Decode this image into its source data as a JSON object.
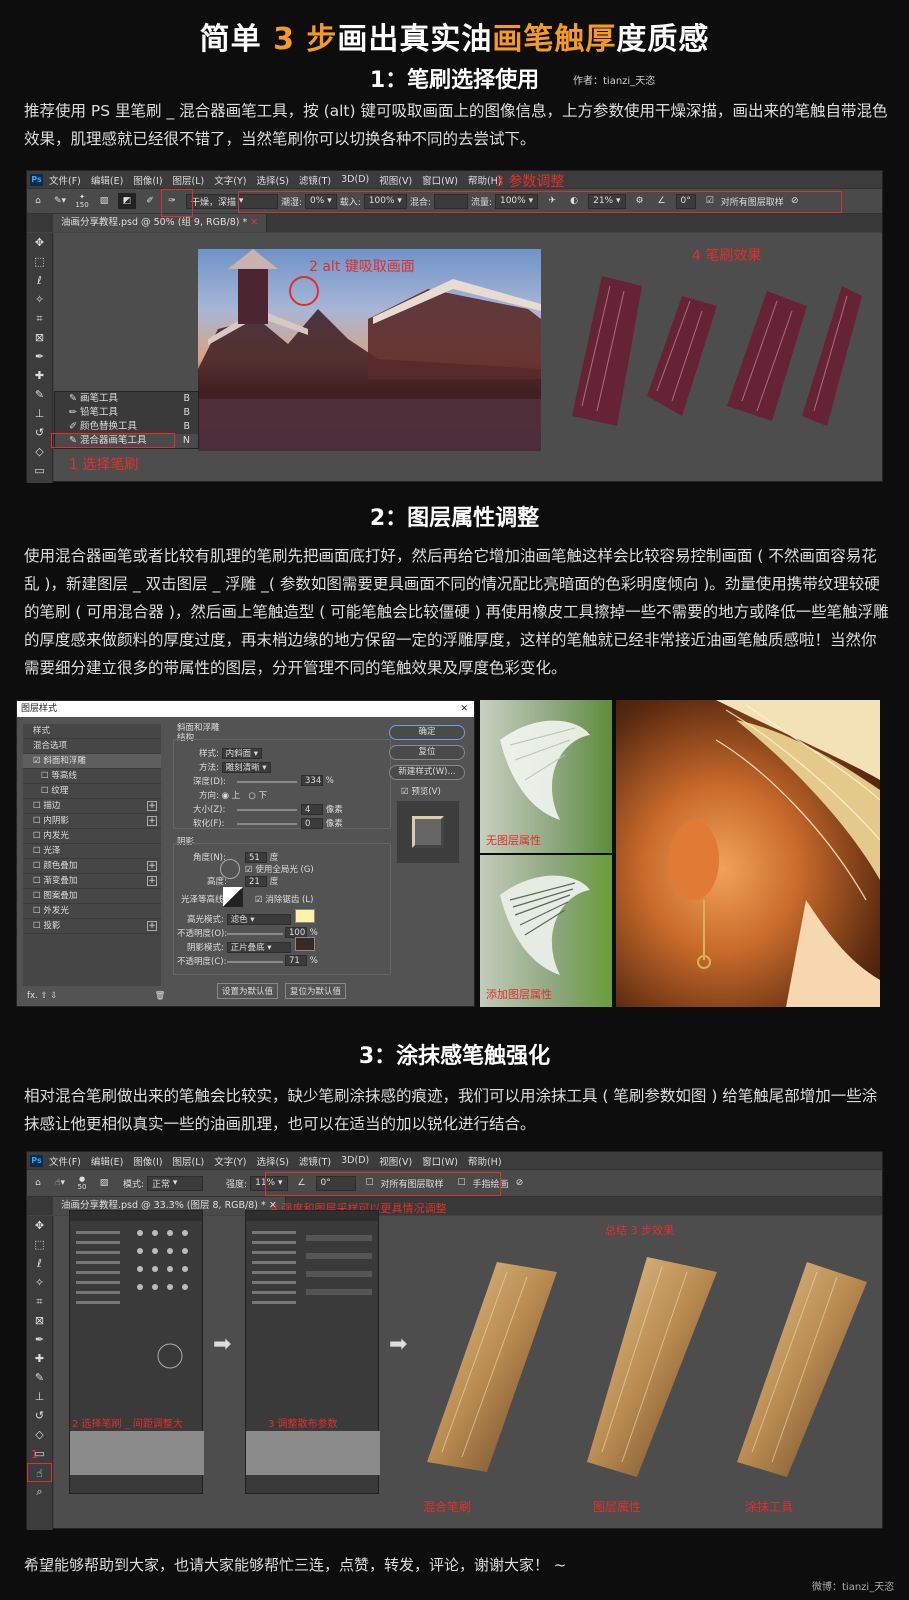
{
  "title": {
    "pre": "简单 ",
    "num": "3 步",
    "mid": "画出真实油",
    "hl": "画笔触厚",
    "post": "度质感"
  },
  "author": "作者：tianzi_天恣",
  "step1": {
    "heading": "1：笔刷选择使用",
    "para": "推荐使用 PS 里笔刷 _ 混合器画笔工具，按 (alt) 键可吸取画面上的图像信息，上方参数使用干燥深描，画出来的笔触自带混色效果，肌理感就已经很不错了，当然笔刷你可以切换各种不同的去尝试下。",
    "menu": [
      "文件(F)",
      "编辑(E)",
      "图像(I)",
      "图层(L)",
      "文字(Y)",
      "选择(S)",
      "滤镜(T)",
      "3D(D)",
      "视图(V)",
      "窗口(W)",
      "帮助(H)"
    ],
    "ps_logo": "Ps",
    "opt": {
      "preset": "干燥，深描",
      "wet_label": "潮湿:",
      "wet": "0%",
      "load_label": "载入:",
      "load": "100%",
      "mix_label": "混合:",
      "flow_label": "流量:",
      "flow": "100%",
      "smooth": "21%",
      "angle": "0°",
      "sample_all": "对所有图层取样",
      "size": "150"
    },
    "tab": "油画分享教程.psd @ 50% (组 9, RGB/8) *",
    "popup": [
      {
        "label": "画笔工具",
        "key": "B"
      },
      {
        "label": "铅笔工具",
        "key": "B"
      },
      {
        "label": "颜色替换工具",
        "key": "B"
      },
      {
        "label": "混合器画笔工具",
        "key": "N"
      }
    ],
    "labels": {
      "l1": "1 选择笔刷",
      "l2": "2 alt 键吸取画面",
      "l3": "3 参数调整",
      "l4": "4 笔刷效果"
    }
  },
  "step2": {
    "heading": "2：图层属性调整",
    "para": "使用混合器画笔或者比较有肌理的笔刷先把画面底打好，然后再给它增加油画笔触这样会比较容易控制画面 ( 不然画面容易花乱 )，新建图层 _ 双击图层 _ 浮雕 _( 参数如图需要更具画面不同的情况配比亮暗面的色彩明度倾向 )。劲量使用携带纹理较硬的笔刷 ( 可用混合器 )，然后画上笔触造型 ( 可能笔触会比较僵硬 ) 再使用橡皮工具擦掉一些不需要的地方或降低一些笔触浮雕的厚度感来做颜料的厚度过度，再末梢边缘的地方保留一定的浮雕厚度，这样的笔触就已经非常接近油画笔触质感啦！当然你需要细分建立很多的带属性的图层，分开管理不同的笔触效果及厚度色彩变化。",
    "dialog": {
      "title": "图层样式",
      "close": "✕",
      "styles": [
        "样式",
        "混合选项",
        "斜面和浮雕",
        "等高线",
        "纹理",
        "描边",
        "内阴影",
        "内发光",
        "光泽",
        "颜色叠加",
        "渐变叠加",
        "图案叠加",
        "外发光",
        "投影"
      ],
      "group1": "斜面和浮雕",
      "group1_sub": "结构",
      "style_label": "样式:",
      "style_val": "内斜面",
      "method_label": "方法:",
      "method_val": "雕刻清晰",
      "depth_label": "深度(D):",
      "depth_val": "334",
      "pct": "%",
      "dir_label": "方向:",
      "dir_up": "上",
      "dir_down": "下",
      "size_label": "大小(Z):",
      "size_val": "4",
      "px": "像素",
      "soft_label": "软化(F):",
      "soft_val": "0",
      "shade": "阴影",
      "angle_label": "角度(N):",
      "angle_val": "51",
      "deg": "度",
      "global": "使用全局光 (G)",
      "alt_label": "高度:",
      "alt_val": "21",
      "gloss_label": "光泽等高线:",
      "aa": "消除锯齿 (L)",
      "hl_label": "高光模式:",
      "hl_val": "滤色",
      "op_label": "不透明度(O):",
      "op_val": "100",
      "sh_label": "阴影模式:",
      "sh_val": "正片叠底",
      "op2_label": "不透明度(C):",
      "op2_val": "71",
      "def1": "设置为默认值",
      "def2": "复位为默认值",
      "ok": "确定",
      "reset": "复位",
      "new": "新建样式(W)...",
      "preview": "预览(V)"
    },
    "cap1": "无图层属性",
    "cap2": "添加图层属性"
  },
  "step3": {
    "heading": "3：涂抹感笔触强化",
    "para": "相对混合笔刷做出来的笔触会比较实，缺少笔刷涂抹感的痕迹，我们可以用涂抹工具 ( 笔刷参数如图 ) 给笔触尾部增加一些涂抹感让他更相似真实一些的油画肌理，也可以在适当的加以锐化进行结合。",
    "opt": {
      "size": "50",
      "mode_label": "模式:",
      "mode": "正常",
      "strength_label": "强度:",
      "strength": "11%",
      "angle": "0°",
      "sample_all": "对所有图层取样",
      "finger": "手指绘画"
    },
    "tab": "油画分享教程.psd @ 33.3% (图层 8, RGB/8) *",
    "labels": {
      "l1": "1",
      "l2": "2 选择笔刷 _ 间距调整大",
      "l3": "3 调整散布参数",
      "l4": "4 强度和图层采样可以更具情况调整",
      "summary": "总结 3 步效果"
    },
    "caps": [
      "混合笔刷",
      "图层属性",
      "涂抹工具"
    ]
  },
  "footer": "希望能够帮助到大家，也请大家能够帮忙三连，点赞，转发，评论，谢谢大家！ ~",
  "weibo": "微博：tianzi_天恣",
  "colors": {
    "accent": "#f39a2b",
    "annotation": "#e0302a",
    "ps_bg": "#434343"
  }
}
